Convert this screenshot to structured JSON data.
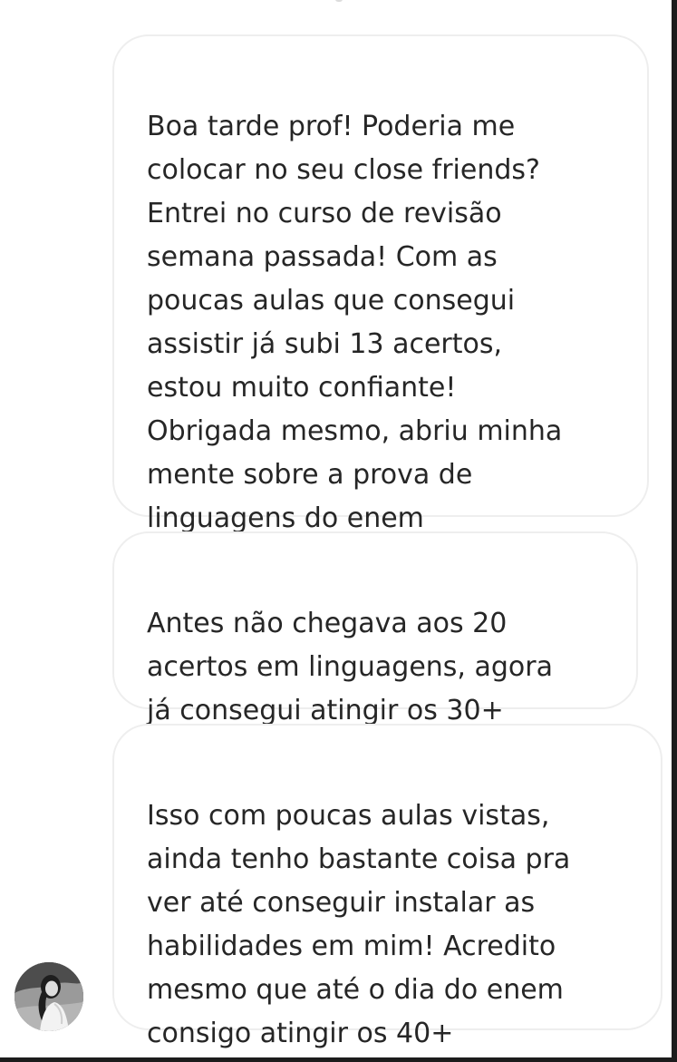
{
  "messages": [
    {
      "text": "Boa tarde prof! Poderia me\ncolocar no seu close friends?\nEntrei no curso de revisão\nsemana passada! Com as\npoucas aulas que consegui\nassistir já subi 13 acertos,\nestou muito confiante!\nObrigada mesmo, abriu minha\nmente sobre a prova de\nlinguagens do enem"
    },
    {
      "text": "Antes não chegava aos 20\nacertos em linguagens, agora\njá consegui atingir os 30+"
    },
    {
      "text": "Isso com poucas aulas vistas,\nainda tenho bastante coisa pra\nver até conseguir instalar as\nhabilidades em mim! Acredito\nmesmo que até o dia do enem\nconsigo atingir os 40+"
    }
  ],
  "colors": {
    "bubble_border": "#eeeeee",
    "message_text": "#262626",
    "background": "#ffffff",
    "frame_edge": "#1c1c1c"
  },
  "icons": {
    "avatar": "sender-profile-photo"
  }
}
